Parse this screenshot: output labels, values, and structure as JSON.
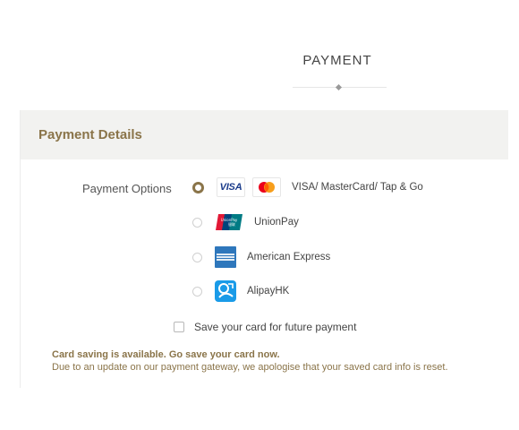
{
  "page": {
    "title": "PAYMENT"
  },
  "panel": {
    "title": "Payment Details",
    "options_label": "Payment Options",
    "options": [
      {
        "label": "VISA/ MasterCard/ Tap & Go",
        "selected": true,
        "logo_text": "VISA"
      },
      {
        "label": "UnionPay",
        "selected": false
      },
      {
        "label": "American Express",
        "selected": false
      },
      {
        "label": "AlipayHK",
        "selected": false
      }
    ],
    "save_card_label": "Save your card for future payment",
    "save_card_checked": false,
    "notice_title": "Card saving is available. Go save your card now.",
    "notice_body": "Due to an update on our payment gateway, we apologise that your saved card info is reset."
  },
  "icons": [
    "visa-icon",
    "mastercard-icon",
    "unionpay-icon",
    "amex-icon",
    "alipayhk-icon"
  ],
  "colors": {
    "accent": "#8a7449",
    "header_bg": "#f2f2f0",
    "text": "#444444"
  }
}
